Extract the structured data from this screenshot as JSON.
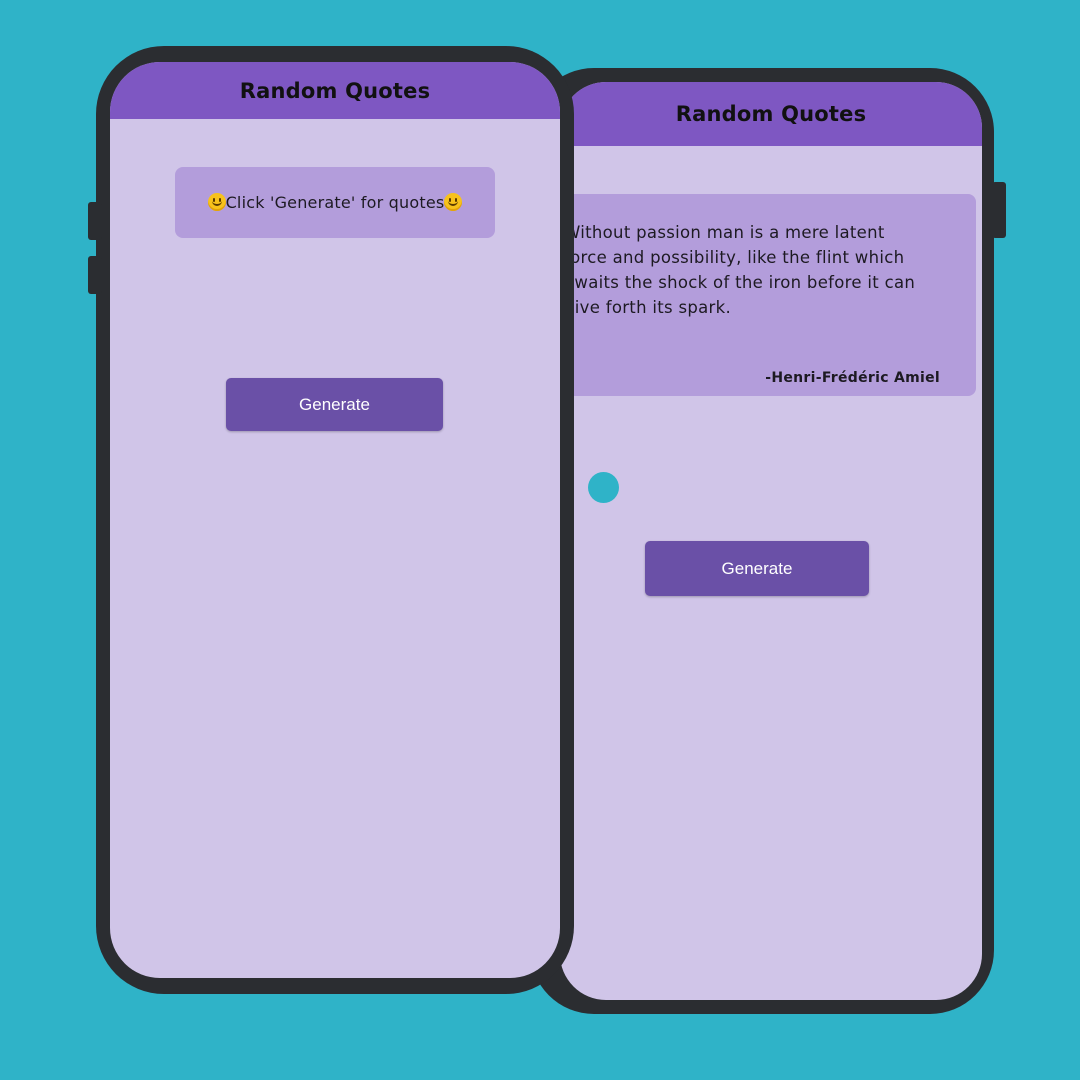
{
  "colors": {
    "background": "#2fb3c8",
    "phone_frame": "#2b2d31",
    "screen_bg": "#d0c5e8",
    "app_bar": "#7e57c2",
    "card_bg": "#b39ddb",
    "button_bg": "#6a50a7",
    "loading_dot": "#2fb3c8"
  },
  "phone_left": {
    "app_title": "Random Quotes",
    "prompt_text": "Click 'Generate' for quotes",
    "prompt_icon": "smiley-face-icon",
    "generate_label": "Generate"
  },
  "phone_right": {
    "app_title": "Random Quotes",
    "quote_lines": [
      "Without passion man is a mere latent",
      "force and possibility, like the flint which",
      "awaits the shock of the iron before it can",
      "give forth its spark."
    ],
    "author": "-Henri-Frédéric Amiel",
    "generate_label": "Generate"
  }
}
